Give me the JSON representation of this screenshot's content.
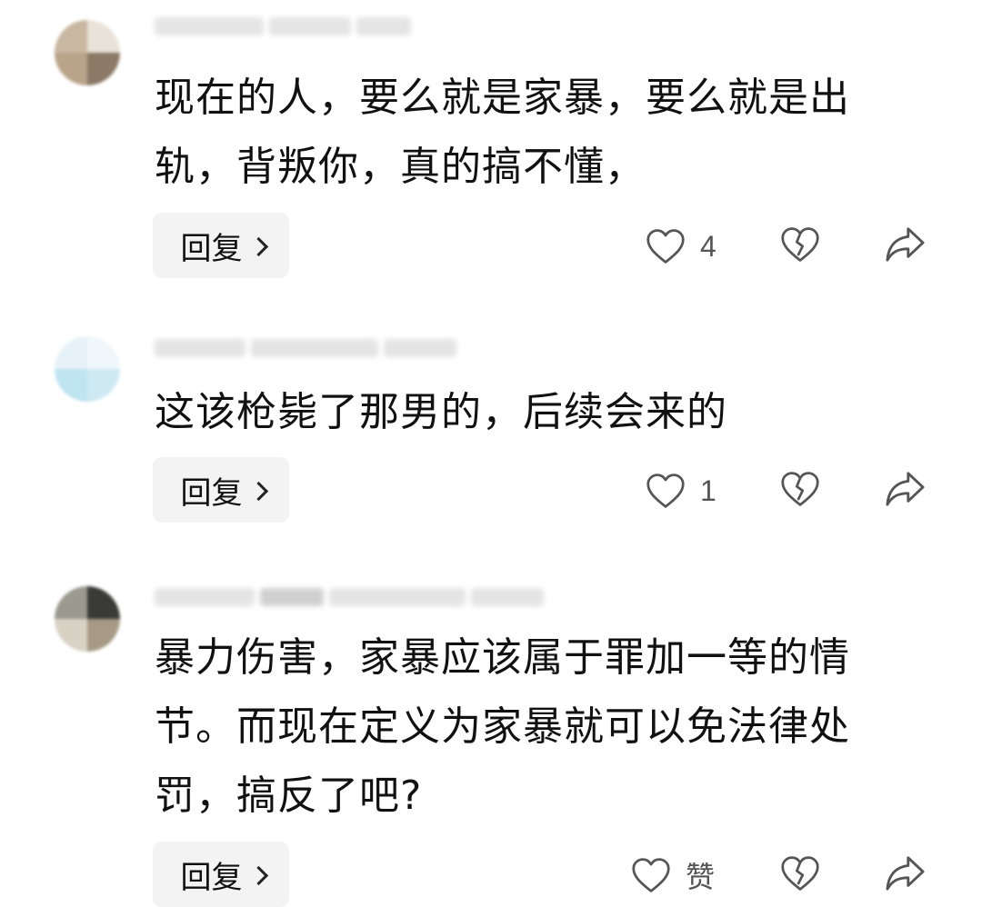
{
  "comments": [
    {
      "text": "现在的人，要么就是家暴，要么就是出轨，背叛你，真的搞不懂，",
      "reply_label": "回复",
      "like_count": "4"
    },
    {
      "text": "这该枪毙了那男的，后续会来的",
      "reply_label": "回复",
      "like_count": "1"
    },
    {
      "text": "暴力伤害，家暴应该属于罪加一等的情节。而现在定义为家暴就可以免法律处罚，搞反了吧?",
      "reply_label": "回复",
      "like_count": "赞"
    }
  ],
  "icons": {
    "like": "heart-outline-icon",
    "dislike": "broken-heart-icon",
    "share": "share-arrow-icon"
  },
  "colors": {
    "text": "#111111",
    "icon": "#555555",
    "reply_bg": "#f3f3f3"
  }
}
